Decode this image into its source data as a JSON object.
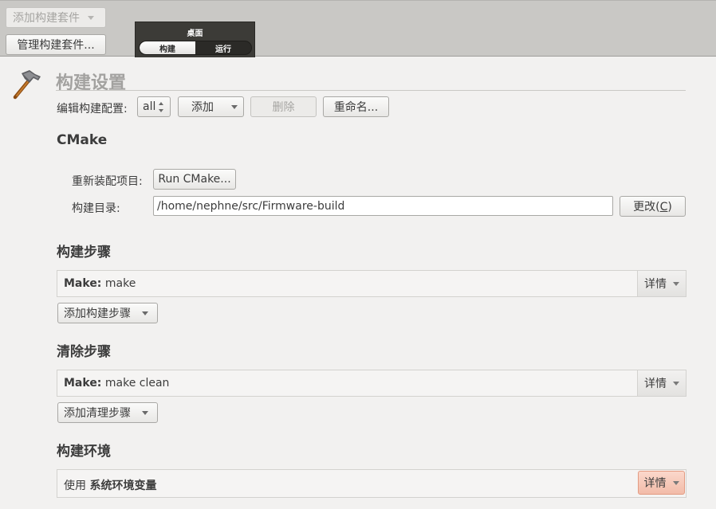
{
  "topbar": {
    "kit_selector": "添加构建套件",
    "manage_kits": "管理构建套件...",
    "mode": {
      "title": "桌面",
      "tabs": [
        {
          "label": "构建",
          "active": true
        },
        {
          "label": "运行",
          "active": false
        }
      ]
    }
  },
  "page": {
    "icon": "hammer-icon",
    "title": "构建设置"
  },
  "config": {
    "label": "编辑构建配置:",
    "value": "all",
    "add": "添加",
    "remove": "删除",
    "rename": "重命名..."
  },
  "cmake": {
    "title": "CMake",
    "reconfigure_label": "重新装配项目:",
    "run_cmake": "Run CMake...",
    "build_dir_label": "构建目录:",
    "build_dir_value": "/home/nephne/src/Firmware-build",
    "change": "更改(",
    "change_key": "C",
    "change_end": ")"
  },
  "build_steps": {
    "title": "构建步骤",
    "step_name": "Make:",
    "step_cmd": "make",
    "details": "详情",
    "add_step": "添加构建步骤"
  },
  "clean_steps": {
    "title": "清除步骤",
    "step_name": "Make:",
    "step_cmd": "make clean",
    "details": "详情",
    "add_step": "添加清理步骤"
  },
  "build_env": {
    "title": "构建环境",
    "use_prefix": "使用",
    "env_name": "系统环境变量",
    "details": "详情"
  },
  "colors": {
    "topbar": "#c9c8c5",
    "mode_selector": "#3c3b37",
    "highlight": "#f2bca9"
  }
}
